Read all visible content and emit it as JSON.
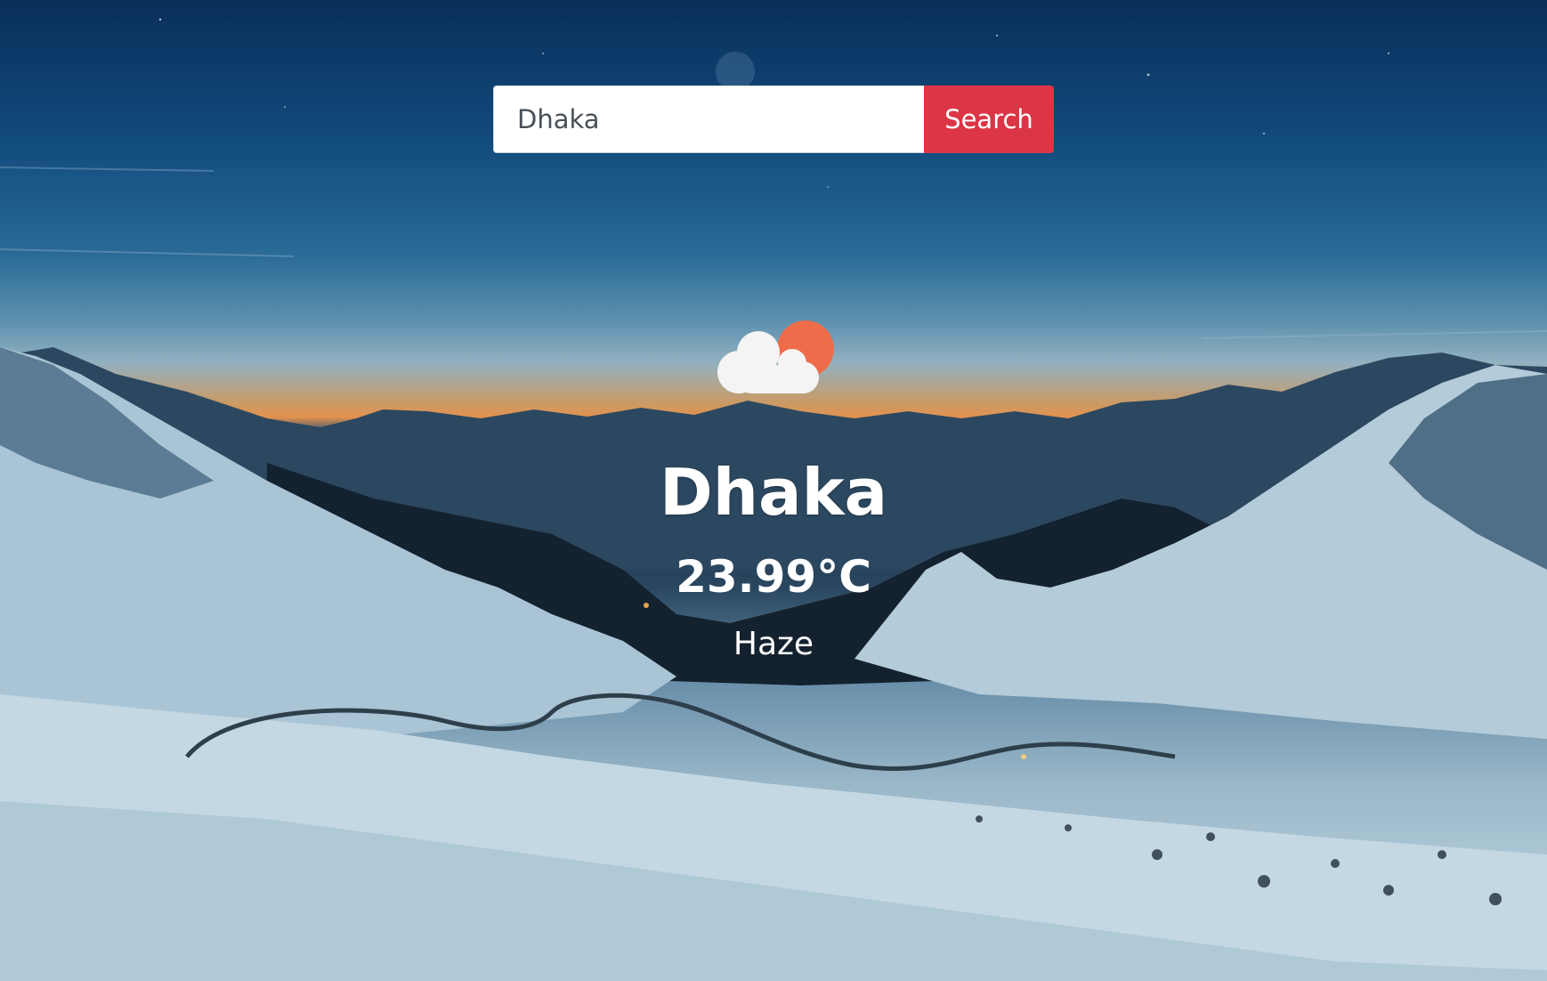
{
  "search": {
    "value": "Dhaka",
    "placeholder": "",
    "button_label": "Search",
    "button_color": "#dc3545"
  },
  "weather": {
    "icon": "partly-cloudy-icon",
    "city": "Dhaka",
    "temperature": "23.99°C",
    "condition": "Haze"
  },
  "background": {
    "scene": "snowy-mountains-dusk-image"
  }
}
